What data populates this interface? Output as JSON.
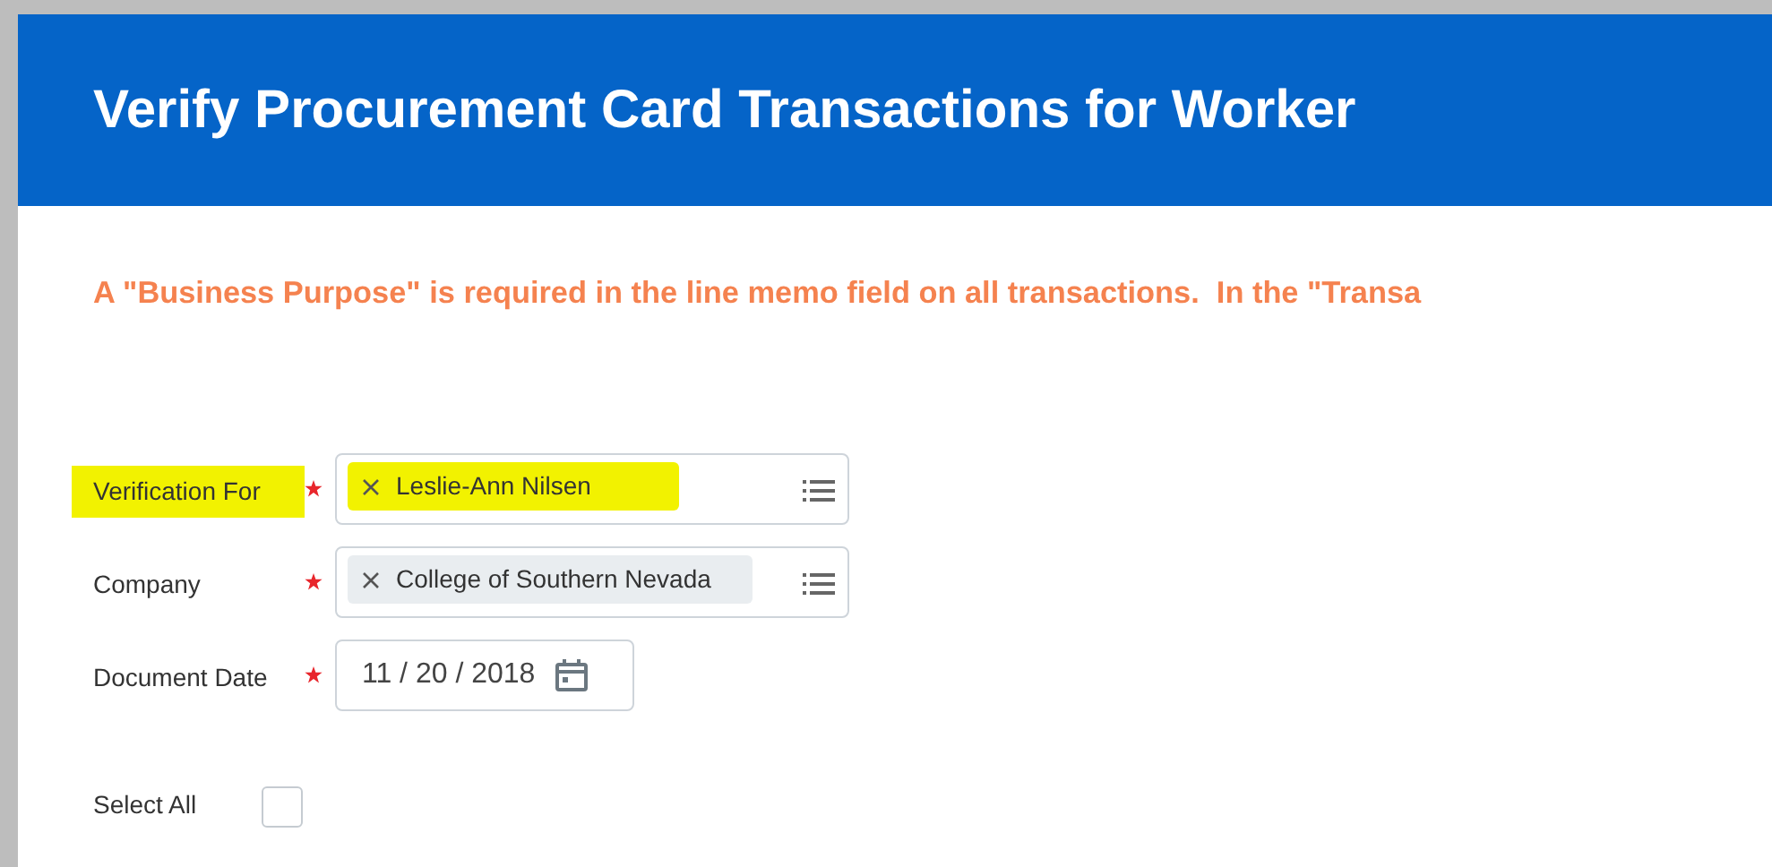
{
  "header": {
    "title": "Verify Procurement Card Transactions for Worker"
  },
  "notice": "A \"Business Purpose\" is required in the line memo field on all transactions.  In the \"Transa",
  "fields": [
    {
      "kind": "multiselect",
      "label": "Verification For",
      "required": true,
      "highlighted": true,
      "chips": [
        "Leslie-Ann Nilsen"
      ]
    },
    {
      "kind": "multiselect",
      "label": "Company",
      "required": true,
      "highlighted": false,
      "chips": [
        "College of Southern Nevada"
      ]
    },
    {
      "kind": "date",
      "label": "Document Date",
      "required": true,
      "highlighted": false,
      "value": "11 / 20 / 2018"
    },
    {
      "kind": "checkbox",
      "label": "Select All",
      "checked": false
    }
  ]
}
